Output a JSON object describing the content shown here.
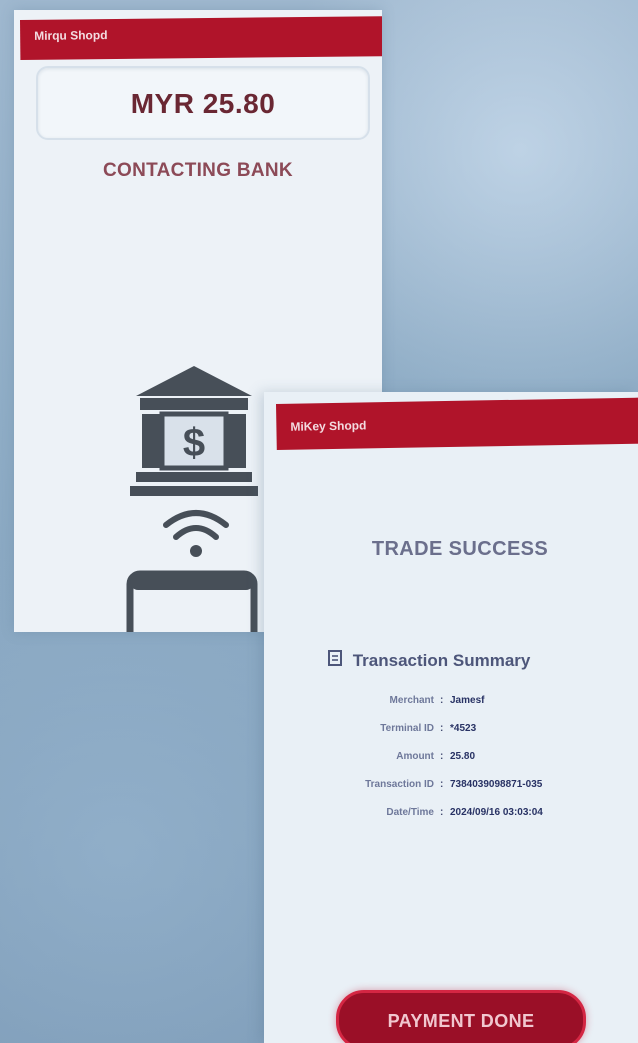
{
  "colors": {
    "brand_red": "#b0142a",
    "button_red": "#9a0f27",
    "panel_bg": "#edf2f7",
    "background_blue": "#8fadc6"
  },
  "processing_screen": {
    "header_title": "Mirqu Shopd",
    "amount": "MYR 25.80",
    "status": "CONTACTING BANK",
    "icons": [
      "bank-dollar-icon",
      "wifi-signal-icon",
      "phone-icon"
    ]
  },
  "result_screen": {
    "header_title": "MiKey Shopd",
    "status": "TRADE SUCCESS",
    "summary_title": "Transaction Summary",
    "summary_icon": "document-icon",
    "summary_rows": [
      {
        "label": "Merchant",
        "value": "Jamesf"
      },
      {
        "label": "Terminal ID",
        "value": "*4523"
      },
      {
        "label": "Amount",
        "value": "25.80"
      },
      {
        "label": "Transaction ID",
        "value": "7384039098871-035"
      },
      {
        "label": "Date/Time",
        "value": "2024/09/16 03:03:04"
      }
    ],
    "button_label": "PAYMENT DONE"
  }
}
